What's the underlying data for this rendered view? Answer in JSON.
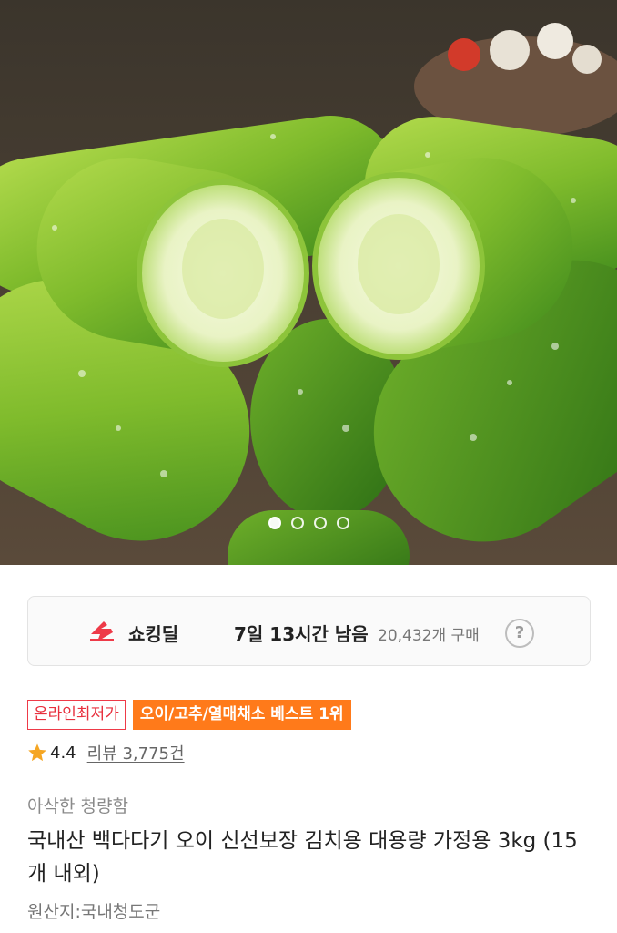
{
  "hero": {
    "image_alt": "cucumbers",
    "carousel": {
      "count": 4,
      "active_index": 0
    }
  },
  "deal": {
    "icon": "shocking-deal-icon",
    "label": "쇼킹딜",
    "time_remaining": "7일 13시간 남음",
    "purchase_count": "20,432개 구매",
    "help_glyph": "?"
  },
  "badges": {
    "lowest_price": "온라인최저가",
    "best_rank": "오이/고추/열매채소 베스트 1위"
  },
  "rating": {
    "score": "4.4",
    "reviews": "리뷰 3,775건"
  },
  "product": {
    "subtitle": "아삭한 청량함",
    "title": "국내산 백다다기 오이 신선보장 김치용 대용량 가정용 3kg (15개 내외)",
    "origin": "원산지:국내청도군"
  },
  "colors": {
    "accent_red": "#ee3a48",
    "accent_orange": "#ff7a1a",
    "star": "#f5a623"
  }
}
